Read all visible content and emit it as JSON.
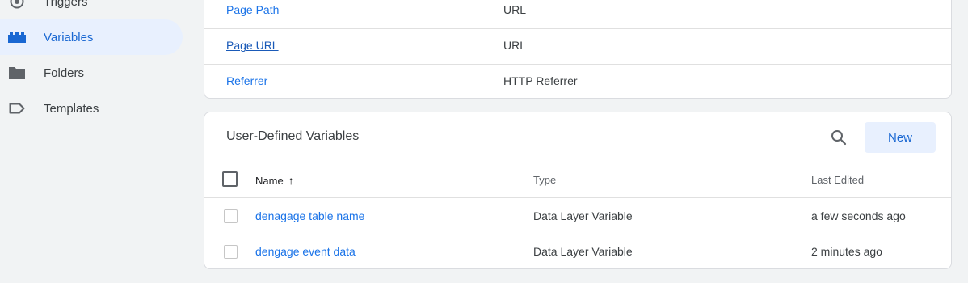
{
  "sidebar": {
    "items": [
      {
        "label": "Triggers",
        "icon": "trigger-icon"
      },
      {
        "label": "Variables",
        "icon": "variables-icon",
        "active": true
      },
      {
        "label": "Folders",
        "icon": "folder-icon"
      },
      {
        "label": "Templates",
        "icon": "template-icon"
      }
    ]
  },
  "builtin": {
    "rows": [
      {
        "name": "Page Path",
        "type": "URL"
      },
      {
        "name": "Page URL",
        "type": "URL"
      },
      {
        "name": "Referrer",
        "type": "HTTP Referrer"
      }
    ]
  },
  "user_defined": {
    "title": "User-Defined Variables",
    "new_label": "New",
    "columns": {
      "name": "Name",
      "sort_arrow": "↑",
      "type": "Type",
      "last_edited": "Last Edited"
    },
    "rows": [
      {
        "name": "denagage table name",
        "type": "Data Layer Variable",
        "last_edited": "a few seconds ago"
      },
      {
        "name": "dengage event data",
        "type": "Data Layer Variable",
        "last_edited": "2 minutes ago"
      }
    ]
  },
  "colors": {
    "accent": "#1a73e8",
    "active_bg": "#e8f0fe",
    "page_bg": "#f1f3f4"
  }
}
